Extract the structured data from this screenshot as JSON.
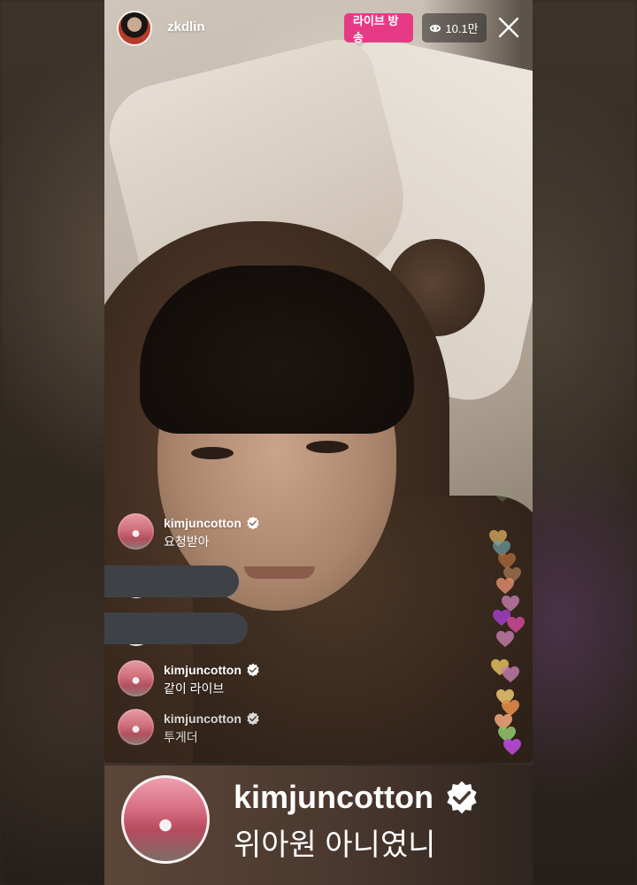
{
  "header": {
    "host_username": "zkdlin",
    "live_badge_label": "라이브 방송",
    "viewer_count": "10.1만"
  },
  "comments": [
    {
      "username": "kimjuncotton",
      "text": "요청받아"
    },
    {
      "username": "kimjuncotton",
      "text": "같이 라이브"
    },
    {
      "username": "kimjuncotton",
      "text": "투게더"
    }
  ],
  "banner": {
    "username": "kimjuncotton",
    "text": "위아원 아니였니"
  },
  "icons": {
    "close": "close-icon",
    "viewers": "eye-icon",
    "verified": "verified-badge-icon",
    "hearts": "heart-icon"
  },
  "colors": {
    "live_badge": "#e73a86",
    "verified": "#ffffff"
  }
}
